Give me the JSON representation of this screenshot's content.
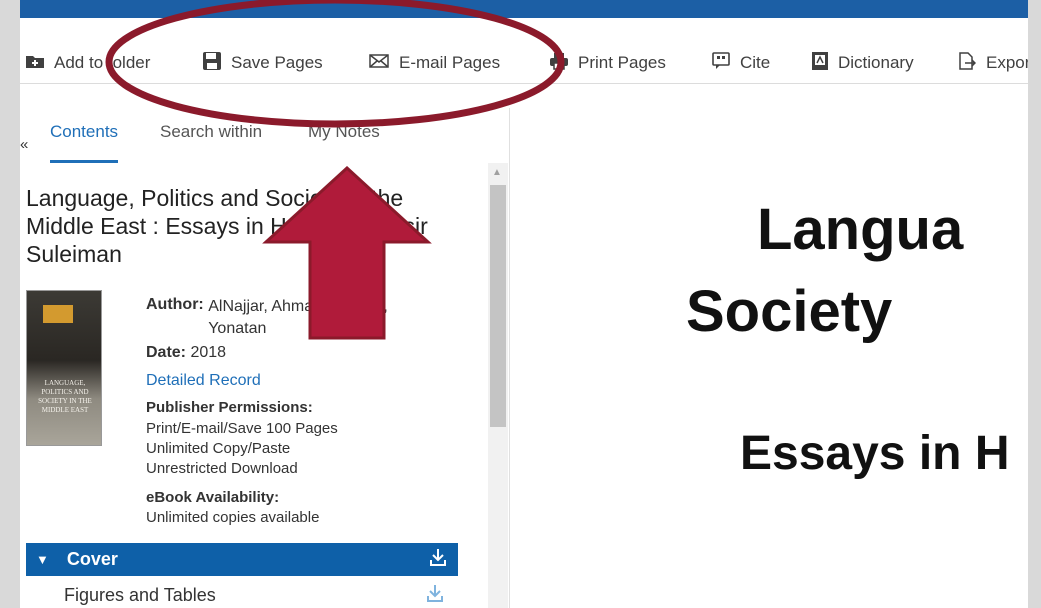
{
  "toolbar": {
    "add_folder": "Add to folder",
    "save_pages": "Save Pages",
    "email_pages": "E-mail Pages",
    "print_pages": "Print Pages",
    "cite": "Cite",
    "dictionary": "Dictionary",
    "export": "Export"
  },
  "sidebar": {
    "collapse_glyph": "«",
    "tabs": [
      "Contents",
      "Search within",
      "My Notes"
    ]
  },
  "book": {
    "title": "Language, Politics and Society in the Middle East : Essays in Honour of Yasir Suleiman",
    "author_label": "Author:",
    "author_value": "AlNajjar, Ahmad; Mendel, Yonatan",
    "date_label": "Date:",
    "date_value": "2018",
    "detailed_record": "Detailed Record",
    "permissions_label": "Publisher Permissions:",
    "permissions": [
      "Print/E-mail/Save 100 Pages",
      "Unlimited Copy/Paste",
      "Unrestricted Download"
    ],
    "availability_label": "eBook Availability:",
    "availability_value": "Unlimited copies available",
    "cover_text": "LANGUAGE, POLITICS AND SOCIETY IN THE MIDDLE EAST"
  },
  "toc": {
    "active_item": "Cover",
    "next_item": "Figures and Tables"
  },
  "document": {
    "line1": "Langua",
    "line2": "Society",
    "line3": "Essays in H"
  },
  "colors": {
    "brand": "#1c5fa5",
    "link": "#1f6fb8",
    "annotation": "#8b1a2b"
  }
}
